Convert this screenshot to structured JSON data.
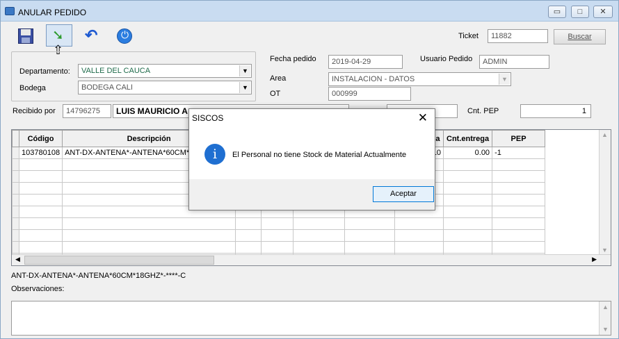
{
  "window": {
    "title": "ANULAR PEDIDO",
    "min_glyph": "▭",
    "max_glyph": "□",
    "close_glyph": "✕"
  },
  "toolbar": {
    "icons": [
      "save-icon",
      "export-icon",
      "undo-icon",
      "power-icon"
    ],
    "export_glyph": "➘",
    "undo_glyph": "↶",
    "power_glyph": "⏻",
    "cursor_glyph": "⇧"
  },
  "ticket": {
    "label": "Ticket",
    "value": "11882",
    "search_label": "Buscar"
  },
  "location": {
    "departamento_label": "Departamento:",
    "departamento_value": "VALLE DEL CAUCA",
    "bodega_label": "Bodega",
    "bodega_value": "BODEGA CALI",
    "dropdown_glyph": "▼"
  },
  "order": {
    "fecha_label": "Fecha pedido",
    "fecha_value": "2019-04-29",
    "usuario_label": "Usuario Pedido",
    "usuario_value": "ADMIN",
    "area_label": "Area",
    "area_value": "INSTALACION - DATOS",
    "ot_label": "OT",
    "ot_value": "000999"
  },
  "receiver": {
    "label": "Recibido por",
    "id_value": "14796275",
    "name_value": "LUIS MAURICIO A",
    "cnt_pep_label": "Cnt. PEP",
    "cnt_pep_value": "1"
  },
  "grid": {
    "columns": [
      "Código",
      "Descripción",
      "",
      "",
      "",
      "",
      "Cnt. pedida",
      "Cnt.entrega",
      "PEP"
    ],
    "rows": [
      [
        "103780108",
        "ANT-DX-ANTENA*-ANTENA*60CM*18",
        "",
        "",
        "",
        "",
        "0.10",
        "0.00",
        "-1"
      ]
    ],
    "empty_rows": 9,
    "scroll_up": "▲",
    "scroll_down": "▼",
    "scroll_left": "◀",
    "scroll_right": "▶"
  },
  "selected_description": "ANT-DX-ANTENA*-ANTENA*60CM*18GHZ*-****-C",
  "observaciones_label": "Observaciones:",
  "dialog": {
    "title": "SISCOS",
    "close_glyph": "✕",
    "info_glyph": "i",
    "message": "El Personal no tiene Stock de Material Actualmente",
    "ok_label": "Aceptar"
  }
}
